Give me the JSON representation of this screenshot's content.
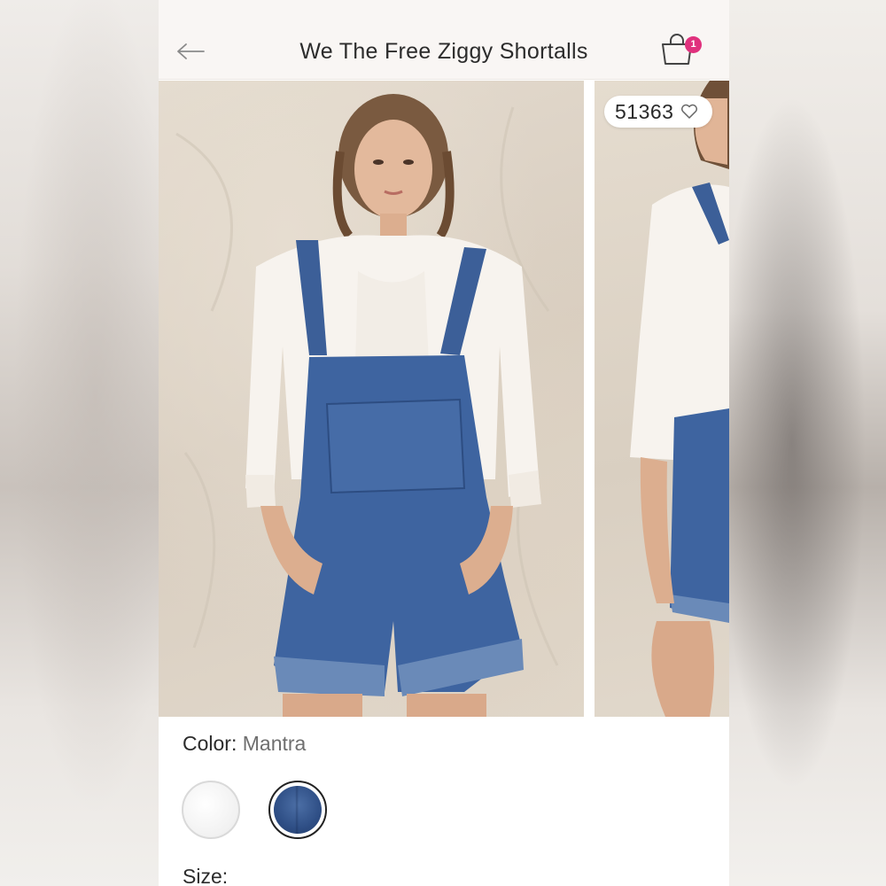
{
  "header": {
    "title": "We The Free Ziggy Shortalls",
    "cart_count": "1"
  },
  "gallery": {
    "like_count": "51363"
  },
  "product": {
    "color_label": "Color:",
    "color_value": "Mantra",
    "size_label": "Size:",
    "swatches": [
      "white",
      "denim"
    ]
  },
  "colors": {
    "badge": "#e0317d",
    "header_bg": "#f9f6f4",
    "text": "#2c2c2c"
  }
}
